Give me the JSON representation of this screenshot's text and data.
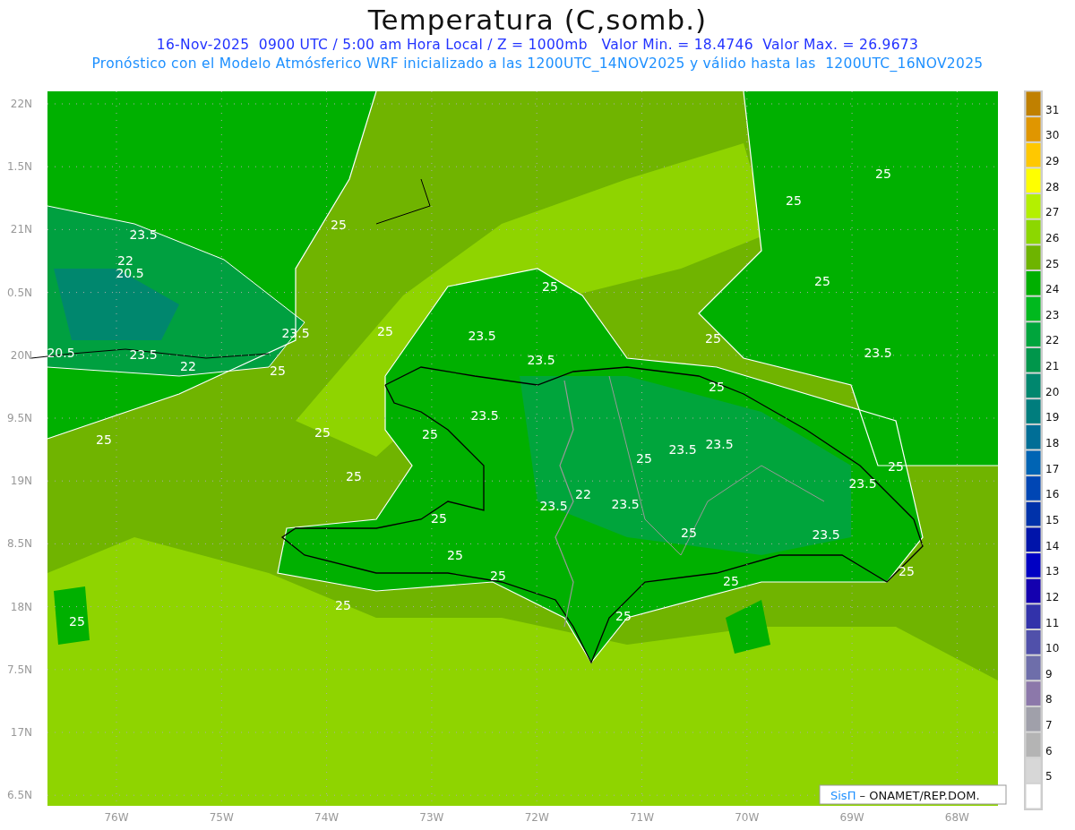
{
  "title": "Temperatura (C,somb.)",
  "subtitle": "16-Nov-2025  0900 UTC / 5:00 am Hora Local / Z = 1000mb   Valor Min. = 18.4746  Valor Max. = 26.9673",
  "caption": "Pronóstico con el Modelo Atmósferico WRF inicializado a las 1200UTC_14NOV2025 y válido hasta las  1200UTC_16NOV2025",
  "lat_ticks": [
    "22N",
    "1.5N",
    "21N",
    "0.5N",
    "20N",
    "9.5N",
    "19N",
    "8.5N",
    "18N",
    "7.5N",
    "17N",
    "6.5N"
  ],
  "lon_ticks": [
    "76W",
    "75W",
    "74W",
    "73W",
    "72W",
    "71W",
    "70W",
    "69W",
    "68W"
  ],
  "contour_labels": [
    "25",
    "25",
    "25",
    "23.5",
    "22",
    "20.5",
    "25",
    "25",
    "23.5",
    "25",
    "23.5",
    "25",
    "20.5",
    "23.5",
    "23.5",
    "23.5",
    "22",
    "25",
    "25",
    "23.5",
    "25",
    "25",
    "25",
    "23.5",
    "23.5",
    "25",
    "25",
    "25",
    "23.5",
    "22",
    "23.5",
    "23.5",
    "25",
    "25",
    "23.5",
    "25",
    "25",
    "25",
    "25",
    "25",
    "25",
    "25"
  ],
  "colorbar": {
    "bins": [
      {
        "color": "#c08000"
      },
      {
        "color": "#e09600"
      },
      {
        "color": "#ffc800"
      },
      {
        "color": "#ffff00"
      },
      {
        "color": "#b4f000"
      },
      {
        "color": "#8cd700"
      },
      {
        "color": "#6eb400"
      },
      {
        "color": "#00af00"
      },
      {
        "color": "#00b91e"
      },
      {
        "color": "#00a53c"
      },
      {
        "color": "#00964b"
      },
      {
        "color": "#00876e"
      },
      {
        "color": "#007d7d"
      },
      {
        "color": "#006e96"
      },
      {
        "color": "#0064b4"
      },
      {
        "color": "#0046b4"
      },
      {
        "color": "#0032aa"
      },
      {
        "color": "#0014aa"
      },
      {
        "color": "#0000c3"
      },
      {
        "color": "#1400af"
      },
      {
        "color": "#3232aa"
      },
      {
        "color": "#5050aa"
      },
      {
        "color": "#6e6eaa"
      },
      {
        "color": "#8c78aa"
      },
      {
        "color": "#a0a0aa"
      },
      {
        "color": "#b4b4b4"
      },
      {
        "color": "#d7d7d7"
      },
      {
        "color": "#ffffff"
      }
    ],
    "labels": [
      "31",
      "30",
      "29",
      "28",
      "27",
      "26",
      "25",
      "24",
      "23",
      "22",
      "21",
      "20",
      "19",
      "18",
      "17",
      "16",
      "15",
      "14",
      "13",
      "12",
      "11",
      "10",
      "9",
      "8",
      "7",
      "6",
      "5"
    ]
  },
  "credit": {
    "brand": "SisΠ",
    "text": "– ONAMET/REP.DOM."
  }
}
